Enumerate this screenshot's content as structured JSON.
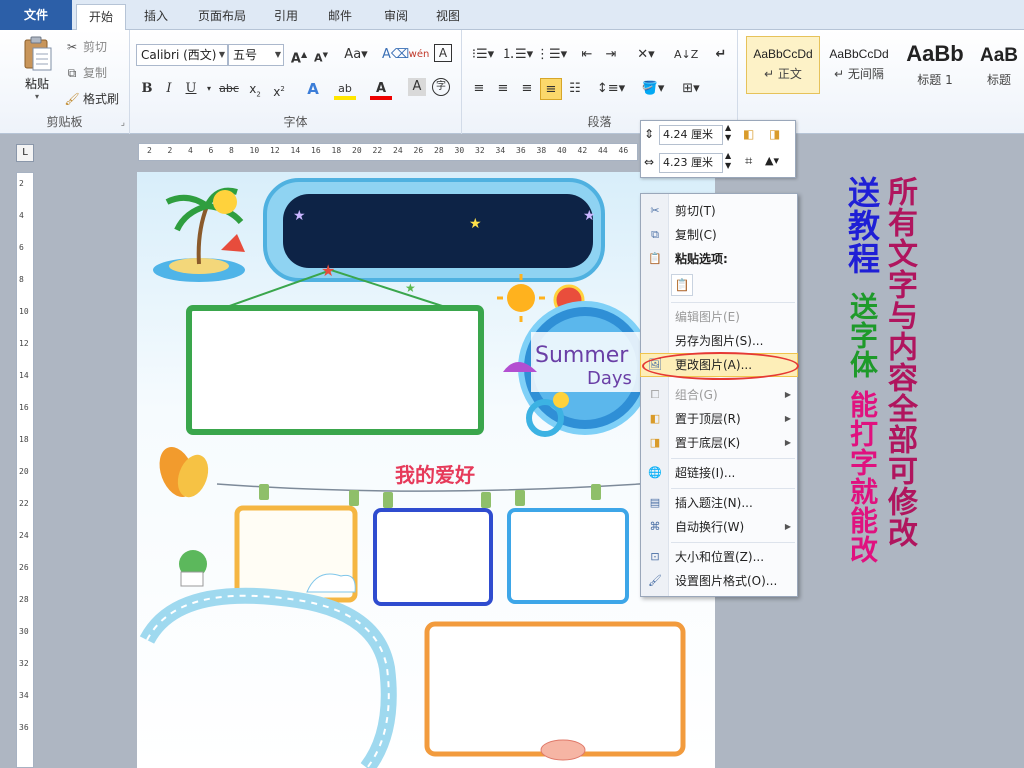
{
  "tabs": {
    "file": "文件",
    "items": [
      "开始",
      "插入",
      "页面布局",
      "引用",
      "邮件",
      "审阅",
      "视图"
    ]
  },
  "clipboard": {
    "paste": "粘贴",
    "cut": "剪切",
    "copy": "复制",
    "format_painter": "格式刷",
    "group": "剪贴板"
  },
  "font": {
    "family": "Calibri (西文)",
    "size": "五号",
    "group": "字体"
  },
  "paragraph": {
    "group": "段落"
  },
  "styles": [
    {
      "sample": "AaBbCcDd",
      "name": "正文"
    },
    {
      "sample": "AaBbCcDd",
      "name": "无间隔"
    },
    {
      "sample": "AaBb",
      "name": "标题 1"
    },
    {
      "sample": "AaB",
      "name": "标题"
    }
  ],
  "ruler": {
    "h_ticks": [
      "2",
      "2",
      "4",
      "6",
      "8",
      "10",
      "12",
      "14",
      "16",
      "18",
      "20",
      "22",
      "24",
      "26",
      "28",
      "30",
      "32",
      "34",
      "36",
      "38",
      "40",
      "42",
      "44",
      "46"
    ],
    "v_ticks": [
      "2",
      "4",
      "6",
      "8",
      "10",
      "12",
      "14",
      "16",
      "18",
      "20",
      "22",
      "24",
      "26",
      "28",
      "30",
      "32",
      "34",
      "36"
    ]
  },
  "size_toolbar": {
    "height": "4.24 厘米",
    "width": "4.23 厘米"
  },
  "document": {
    "summer_line1": "Summer",
    "summer_line2": "Days",
    "hobby_title": "我的爱好"
  },
  "context_menu": {
    "cut": "剪切(T)",
    "copy": "复制(C)",
    "paste_options": "粘贴选项:",
    "edit_picture": "编辑图片(E)",
    "save_as_picture": "另存为图片(S)...",
    "change_picture": "更改图片(A)...",
    "group": "组合(G)",
    "bring_to_front": "置于顶层(R)",
    "send_to_back": "置于底层(K)",
    "hyperlink": "超链接(I)...",
    "insert_caption": "插入题注(N)...",
    "wrap_text": "自动换行(W)",
    "size_position": "大小和位置(Z)...",
    "format_picture": "设置图片格式(O)..."
  },
  "promo": {
    "line1": "送教程",
    "line2": "所有文字与内容全部可修改",
    "line3": "送字体",
    "line4": "能打字就能改"
  }
}
